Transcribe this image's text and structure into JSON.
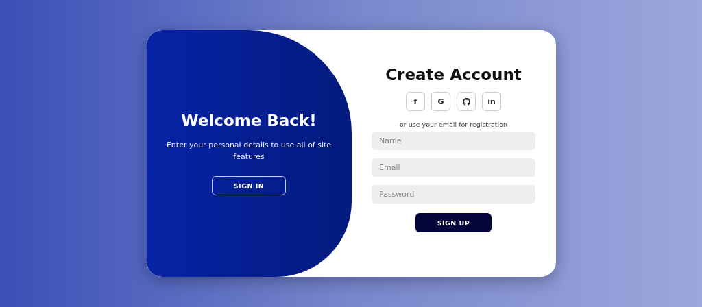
{
  "welcome_panel": {
    "title": "Welcome Back!",
    "text": "Enter your personal details to use all of site features",
    "button": "SIGN IN"
  },
  "form": {
    "title": "Create Account",
    "social_buttons": [
      {
        "kind": "letter",
        "label": "f"
      },
      {
        "kind": "letter",
        "label": "G"
      },
      {
        "kind": "github"
      },
      {
        "kind": "letter",
        "label": "in"
      }
    ],
    "hint": "or use your email for registration",
    "fields": [
      {
        "placeholder": "Name"
      },
      {
        "placeholder": "Email"
      },
      {
        "placeholder": "Password"
      }
    ],
    "button": "SIGN UP"
  }
}
